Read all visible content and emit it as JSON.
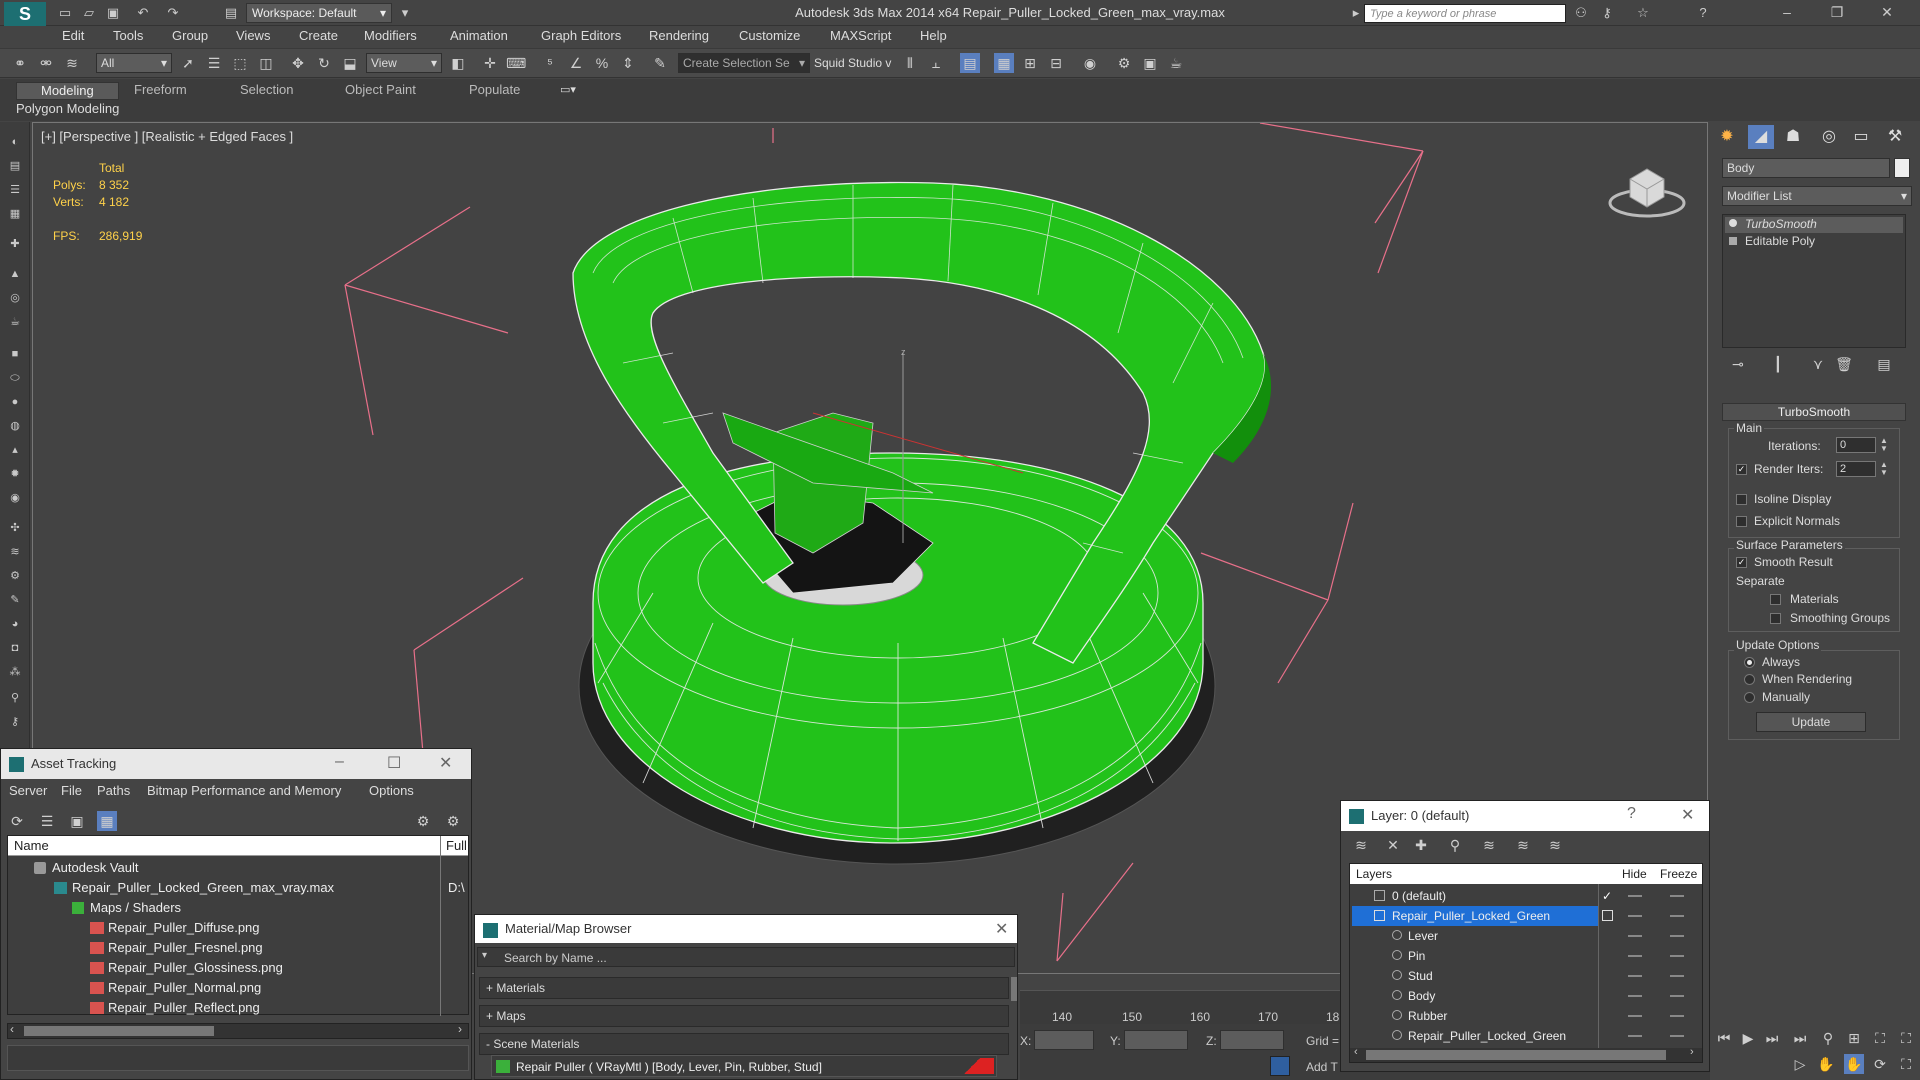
{
  "titlebar": {
    "app_title": "Autodesk 3ds Max  2014 x64     Repair_Puller_Locked_Green_max_vray.max",
    "workspace": "Workspace: Default",
    "search_placeholder": "Type a keyword or phrase"
  },
  "menu": [
    "Edit",
    "Tools",
    "Group",
    "Views",
    "Create",
    "Modifiers",
    "Animation",
    "Graph Editors",
    "Rendering",
    "Customize",
    "MAXScript",
    "Help"
  ],
  "toolbar": {
    "filter": "All",
    "ref_coord": "View",
    "selection_set": "Create Selection Se",
    "squid": "Squid Studio v"
  },
  "ribbon": {
    "tabs": [
      "Modeling",
      "Freeform",
      "Selection",
      "Object Paint",
      "Populate"
    ],
    "active": "Modeling",
    "sub": "Polygon Modeling"
  },
  "viewport": {
    "label": "[+] [Perspective ] [Realistic + Edged Faces ]",
    "stats": {
      "total_label": "Total",
      "polys_label": "Polys:",
      "polys": "8 352",
      "verts_label": "Verts:",
      "verts": "4 182",
      "fps_label": "FPS:",
      "fps": "286,919"
    },
    "axis_label": "z"
  },
  "command_panel": {
    "object_name": "Body",
    "modifier_list": "Modifier List",
    "stack": [
      "TurboSmooth",
      "Editable Poly"
    ],
    "rollout": "TurboSmooth",
    "main_group": "Main",
    "iterations_label": "Iterations:",
    "iterations": "0",
    "render_iters_label": "Render Iters:",
    "render_iters": "2",
    "isoline": "Isoline Display",
    "explicit_normals": "Explicit Normals",
    "surface_group": "Surface Parameters",
    "smooth_result": "Smooth Result",
    "separate": "Separate",
    "materials": "Materials",
    "smoothing_groups": "Smoothing Groups",
    "update_group": "Update Options",
    "always": "Always",
    "when_rendering": "When Rendering",
    "manually": "Manually",
    "update_button": "Update"
  },
  "asset_tracking": {
    "title": "Asset Tracking",
    "menu": [
      "Server",
      "File",
      "Paths",
      "Bitmap Performance and Memory",
      "Options"
    ],
    "col_name": "Name",
    "col_full": "Full",
    "rows": [
      {
        "name": "Autodesk Vault",
        "full": ""
      },
      {
        "name": "Repair_Puller_Locked_Green_max_vray.max",
        "full": "D:\\"
      },
      {
        "name": "Maps / Shaders",
        "full": ""
      },
      {
        "name": "Repair_Puller_Diffuse.png",
        "full": ""
      },
      {
        "name": "Repair_Puller_Fresnel.png",
        "full": ""
      },
      {
        "name": "Repair_Puller_Glossiness.png",
        "full": ""
      },
      {
        "name": "Repair_Puller_Normal.png",
        "full": ""
      },
      {
        "name": "Repair_Puller_Reflect.png",
        "full": ""
      }
    ]
  },
  "material_browser": {
    "title": "Material/Map Browser",
    "search": "Search by Name ...",
    "materials": "+ Materials",
    "maps": "+ Maps",
    "scene": "- Scene Materials",
    "item": "Repair Puller  ( VRayMtl )  [Body, Lever, Pin, Rubber, Stud]"
  },
  "layer_dialog": {
    "title": "Layer: 0 (default)",
    "col_layers": "Layers",
    "col_hide": "Hide",
    "col_freeze": "Freeze",
    "rows": [
      "0 (default)",
      "Repair_Puller_Locked_Green",
      "Lever",
      "Pin",
      "Stud",
      "Body",
      "Rubber",
      "Repair_Puller_Locked_Green"
    ]
  },
  "timeline": {
    "ticks": [
      "140",
      "150",
      "160",
      "170",
      "18"
    ],
    "x_label": "X:",
    "y_label": "Y:",
    "z_label": "Z:",
    "grid": "Grid =",
    "add_t": "Add T"
  },
  "colors": {
    "accent": "#1d6f72",
    "model_green": "#22c21a",
    "selection_blue": "#1f6fd6",
    "stat_yellow": "#ffd24a"
  }
}
